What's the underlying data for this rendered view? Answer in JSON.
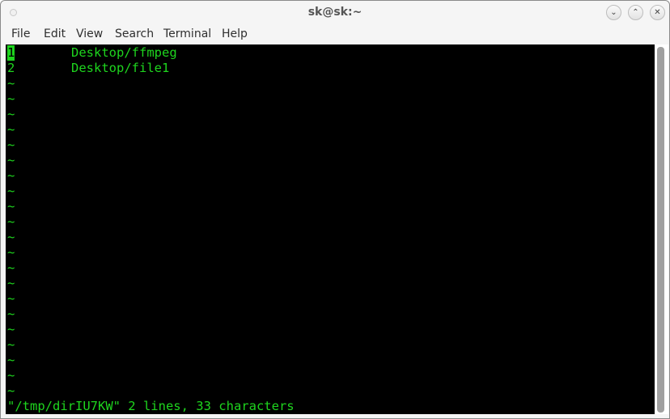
{
  "window": {
    "title": "sk@sk:~",
    "controls": {
      "minimize_glyph": "⌄",
      "maximize_glyph": "⌃",
      "close_glyph": "✕"
    }
  },
  "menubar": {
    "items": [
      "File",
      "Edit",
      "View",
      "Search",
      "Terminal",
      "Help"
    ]
  },
  "terminal": {
    "colors": {
      "foreground": "#1ed51e",
      "background": "#000000"
    },
    "lines": [
      {
        "num": "1",
        "text": "Desktop/ffmpeg",
        "cursor": true
      },
      {
        "num": "2",
        "text": "Desktop/file1",
        "cursor": false
      }
    ],
    "empty_marker": "~",
    "empty_count": 21,
    "status_line": "\"/tmp/dirIU7KW\" 2 lines, 33 characters"
  }
}
